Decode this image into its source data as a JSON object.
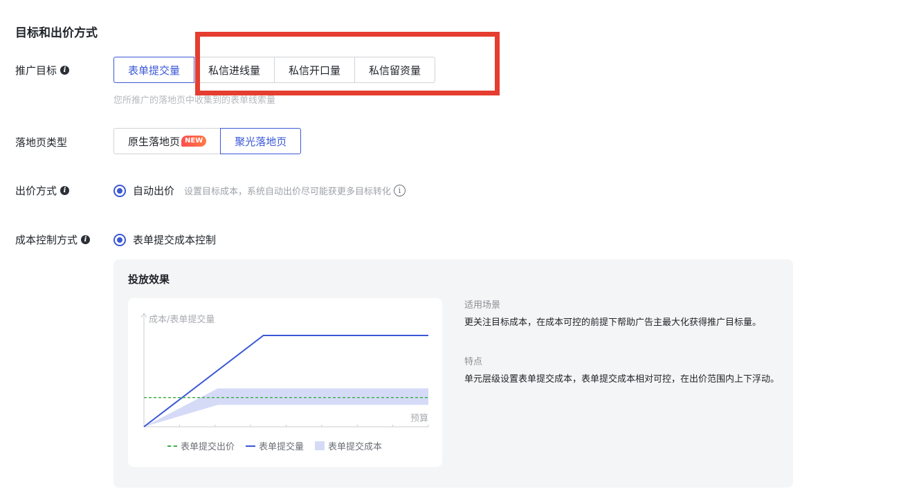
{
  "section_title": "目标和出价方式",
  "promo_goal": {
    "label": "推广目标",
    "options": [
      "表单提交量",
      "私信进线量",
      "私信开口量",
      "私信留资量"
    ],
    "selected_index": 0,
    "hint": "您所推广的落地页中收集到的表单线索量"
  },
  "landing_type": {
    "label": "落地页类型",
    "options": [
      "原生落地页",
      "聚光落地页"
    ],
    "new_badge": "NEW",
    "selected_index": 1
  },
  "bid_method": {
    "label": "出价方式",
    "option": "自动出价",
    "desc": "设置目标成本，系统自动出价尽可能获更多目标转化"
  },
  "cost_control": {
    "label": "成本控制方式",
    "option": "表单提交成本控制"
  },
  "effect": {
    "title": "投放效果",
    "scene_head": "适用场景",
    "scene_text": "更关注目标成本，在成本可控的前提下帮助广告主最大化获得推广目标量。",
    "feature_head": "特点",
    "feature_text": "单元层级设置表单提交成本，表单提交成本相对可控，在出价范围内上下浮动。"
  },
  "chart_data": {
    "type": "line",
    "ylabel": "成本/表单提交量",
    "xlabel": "预算",
    "series": [
      {
        "name": "表单提交出价",
        "style": "dashed",
        "color": "#3fae4a",
        "points": [
          [
            0,
            0.32
          ],
          [
            1,
            0.32
          ]
        ]
      },
      {
        "name": "表单提交量",
        "style": "line",
        "color": "#3a57d6",
        "points": [
          [
            0,
            0
          ],
          [
            0.42,
            1
          ],
          [
            1,
            1
          ]
        ]
      },
      {
        "name": "表单提交成本",
        "style": "band",
        "color": "#d5dbf7",
        "upper": [
          [
            0,
            0
          ],
          [
            0.26,
            0.42
          ],
          [
            1,
            0.42
          ]
        ],
        "lower": [
          [
            0,
            0
          ],
          [
            0.26,
            0.24
          ],
          [
            1,
            0.24
          ]
        ]
      }
    ]
  }
}
